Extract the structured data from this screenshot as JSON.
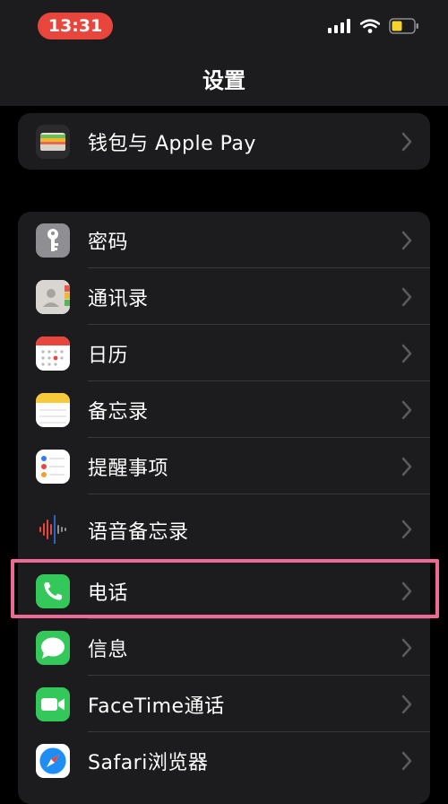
{
  "status": {
    "time": "13:31"
  },
  "header": {
    "title": "设置"
  },
  "wallet_group": {
    "items": [
      {
        "label": "钱包与 Apple Pay",
        "icon": "wallet-icon"
      }
    ]
  },
  "apps_group": {
    "items": [
      {
        "label": "密码",
        "icon": "key-icon"
      },
      {
        "label": "通讯录",
        "icon": "contacts-icon"
      },
      {
        "label": "日历",
        "icon": "calendar-icon"
      },
      {
        "label": "备忘录",
        "icon": "notes-icon"
      },
      {
        "label": "提醒事项",
        "icon": "reminders-icon"
      },
      {
        "label": "语音备忘录",
        "icon": "voice-memos-icon"
      },
      {
        "label": "电话",
        "icon": "phone-icon"
      },
      {
        "label": "信息",
        "icon": "messages-icon"
      },
      {
        "label": "FaceTime通话",
        "icon": "facetime-icon"
      },
      {
        "label": "Safari浏览器",
        "icon": "safari-icon"
      }
    ]
  },
  "colors": {
    "highlight": "#ec6a95",
    "time_pill": "#e8453c",
    "battery": "#f5d52b"
  }
}
